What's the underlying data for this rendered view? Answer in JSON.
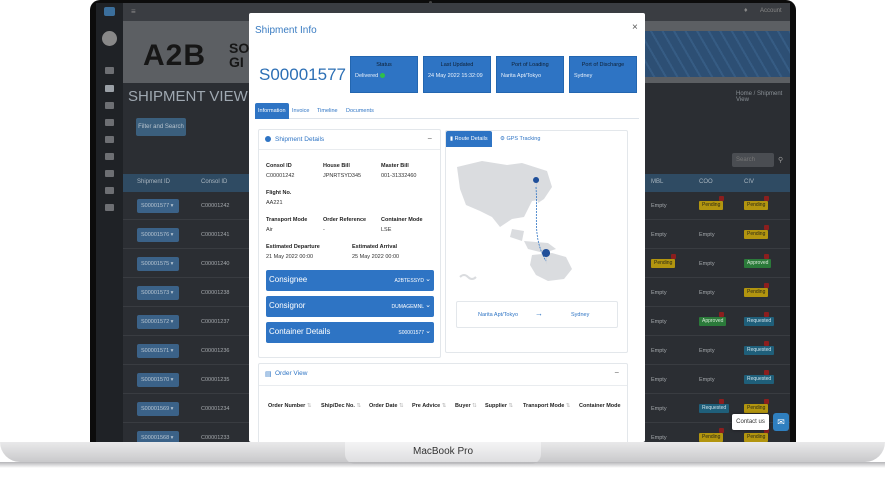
{
  "device": {
    "label": "MacBook Pro"
  },
  "background_app": {
    "topbar": {
      "menu_icon": "≡",
      "bell_icon": "🔔",
      "account": "Account"
    },
    "logo": {
      "main": "A2B",
      "rest_line1": "SO",
      "rest_line2": "GI"
    },
    "page_title": "SHIPMENT VIEW",
    "breadcrumb": "Home / Shipment View",
    "filter_button": "Filter and Search",
    "search_placeholder": "Search",
    "table": {
      "headers": [
        "Shipment ID",
        "Consol ID",
        "MBL",
        "COO",
        "CIV"
      ],
      "rows": [
        {
          "shipment": "S00001577",
          "consol": "C00001242",
          "mbl": "Empty",
          "coo": "Pending",
          "civ": "Pending"
        },
        {
          "shipment": "S00001576",
          "consol": "C00001241",
          "mbl": "Empty",
          "coo": "Empty",
          "civ": "Pending"
        },
        {
          "shipment": "S00001575",
          "consol": "C00001240",
          "mbl": "Pending",
          "coo": "Empty",
          "civ": "Approved"
        },
        {
          "shipment": "S00001573",
          "consol": "C00001238",
          "mbl": "Empty",
          "coo": "Empty",
          "civ": "Pending"
        },
        {
          "shipment": "S00001572",
          "consol": "C00001237",
          "mbl": "Empty",
          "coo": "Approved",
          "civ": "Requested"
        },
        {
          "shipment": "S00001571",
          "consol": "C00001236",
          "mbl": "Empty",
          "coo": "Empty",
          "civ": "Requested"
        },
        {
          "shipment": "S00001570",
          "consol": "C00001235",
          "mbl": "Empty",
          "coo": "Empty",
          "civ": "Requested"
        },
        {
          "shipment": "S00001569",
          "consol": "C00001234",
          "mbl": "Empty",
          "coo": "Requested",
          "civ": "Pending"
        },
        {
          "shipment": "S00001568",
          "consol": "C00001233",
          "mbl": "Empty",
          "coo": "Pending",
          "civ": "Pending"
        }
      ]
    },
    "contact_label": "Contact us"
  },
  "modal": {
    "title": "Shipment Info",
    "close": "×",
    "shipment_id": "S00001577",
    "info_boxes": [
      {
        "label": "Status",
        "value": "Delivered"
      },
      {
        "label": "Last Updated",
        "value": "24 May 2022 15:32:09"
      },
      {
        "label": "Port of Loading",
        "value": "Narita Apt/Tokyo"
      },
      {
        "label": "Port of Discharge",
        "value": "Sydney"
      }
    ],
    "tabs": [
      "Information",
      "Invoice",
      "Timeline",
      "Documents"
    ],
    "details": {
      "title": "Shipment Details",
      "consol_id_label": "Consol ID",
      "consol_id": "C00001242",
      "house_bill_label": "House Bill",
      "house_bill": "JPNRTSYD345",
      "master_bill_label": "Master Bill",
      "master_bill": "001-31332460",
      "flight_no_label": "Flight No.",
      "flight_no": "AA221",
      "transport_mode_label": "Transport Mode",
      "transport_mode": "Air",
      "order_ref_label": "Order Reference",
      "order_ref": "-",
      "container_mode_label": "Container Mode",
      "container_mode": "LSE",
      "est_departure_label": "Estimated Departure",
      "est_departure": "21 May 2022 00:00",
      "est_arrival_label": "Estimated Arrival",
      "est_arrival": "25 May 2022 00:00"
    },
    "accordions": [
      {
        "label": "Consignee",
        "value": "A2BTESSYD"
      },
      {
        "label": "Consignor",
        "value": "DUMAGEMNL"
      },
      {
        "label": "Container Details",
        "value": "S00001577"
      }
    ],
    "route": {
      "tab_route": "Route Details",
      "tab_gps": "GPS Tracking",
      "from": "Narita Apt/Tokyo",
      "arrow": "→",
      "to": "Sydney"
    },
    "order_view": {
      "title": "Order View",
      "headers": [
        "Order Number",
        "Ship/Dec No.",
        "Order Date",
        "Pre Advice",
        "Buyer",
        "Supplier",
        "Transport Mode",
        "Container Mode"
      ]
    }
  },
  "colors": {
    "accent": "#2e74c4",
    "status_green": "#2fbf4a"
  }
}
